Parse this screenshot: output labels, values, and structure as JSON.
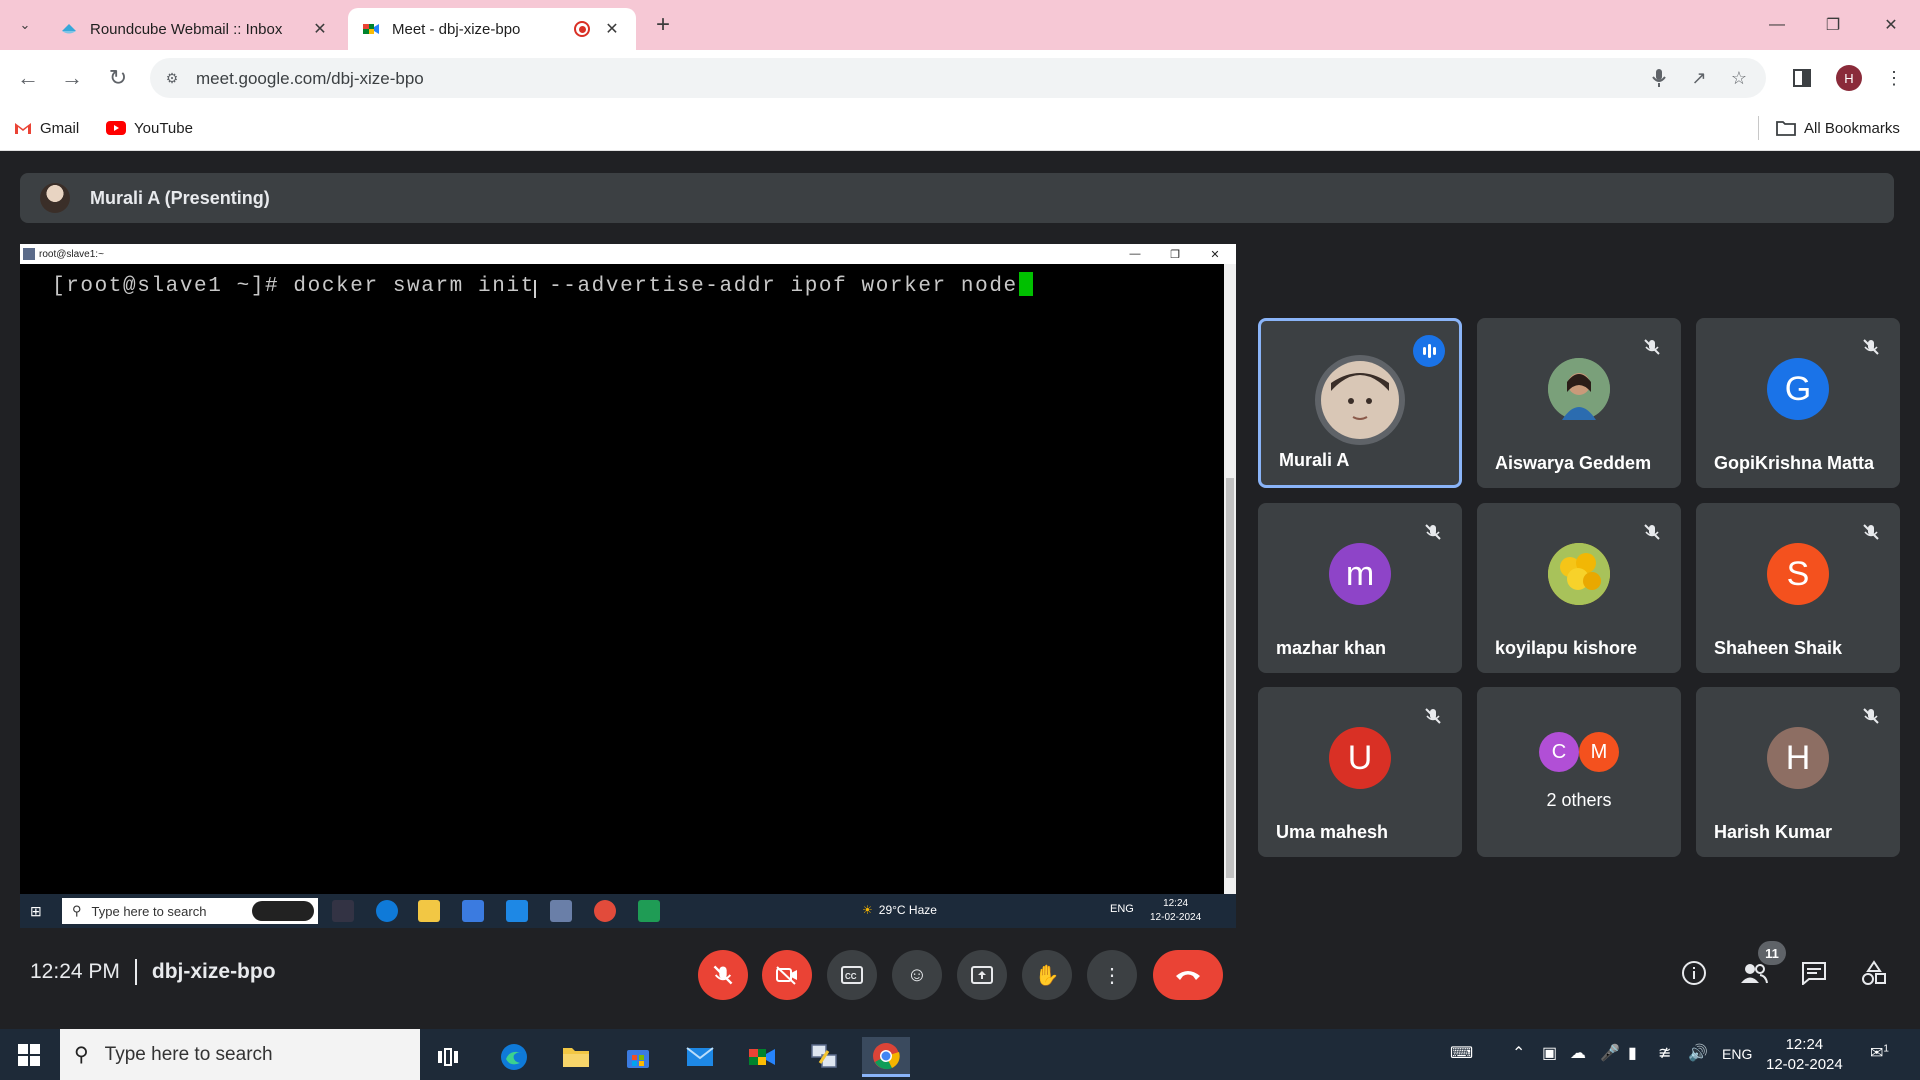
{
  "browser": {
    "tabs": [
      {
        "title": "Roundcube Webmail :: Inbox"
      },
      {
        "title": "Meet - dbj-xize-bpo"
      }
    ],
    "url": "meet.google.com/dbj-xize-bpo",
    "profile_initial": "H",
    "bookmarks": [
      {
        "label": "Gmail"
      },
      {
        "label": "YouTube"
      }
    ],
    "all_bookmarks": "All Bookmarks"
  },
  "meet": {
    "presenting_label": "Murali A (Presenting)",
    "shared_screen": {
      "window_title": "root@slave1:~",
      "terminal_line": "[root@slave1 ~]# docker swarm init --advertise-addr ipof worker node",
      "taskbar": {
        "search_placeholder": "Type here to search",
        "weather": "29°C  Haze",
        "lang": "ENG",
        "time": "12:24",
        "date": "12-02-2024"
      }
    },
    "participants": [
      {
        "name": "Murali A",
        "avatar": "photo",
        "active": true
      },
      {
        "name": "Aiswarya Geddem",
        "avatar": "photo",
        "muted": true
      },
      {
        "name": "GopiKrishna Matta",
        "initial": "G",
        "color": "#1a73e8",
        "muted": true
      },
      {
        "name": "mazhar khan",
        "initial": "m",
        "color": "#8e44c8",
        "muted": true
      },
      {
        "name": "koyilapu kishore",
        "avatar": "photo",
        "muted": true
      },
      {
        "name": "Shaheen Shaik",
        "initial": "S",
        "color": "#f4511e",
        "muted": true
      },
      {
        "name": "Uma mahesh",
        "initial": "U",
        "color": "#d93025",
        "muted": true
      },
      {
        "name": "2 others",
        "initials": [
          "C",
          "M"
        ],
        "colors": [
          "#b14fd6",
          "#f4511e"
        ]
      },
      {
        "name": "Harish Kumar",
        "initial": "H",
        "color": "#8d6e63",
        "muted": true
      }
    ],
    "time": "12:24 PM",
    "meeting_code": "dbj-xize-bpo",
    "people_count": "11"
  },
  "windows_taskbar": {
    "search_placeholder": "Type here to search",
    "lang": "ENG",
    "time": "12:24",
    "date": "12-02-2024",
    "notification_count": "1"
  }
}
